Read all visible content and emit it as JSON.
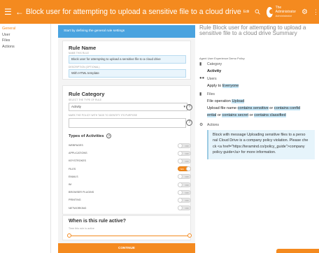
{
  "topbar": {
    "title": "Block user for attempting to upload a sensitive file to a cloud drive",
    "title_small": "Edit",
    "user_name": "The Administrator",
    "user_role": "Administrator"
  },
  "nav": {
    "items": [
      "General",
      "User",
      "Files",
      "Actions"
    ]
  },
  "form": {
    "banner": "Start by defining the general rule settings",
    "rule_name": {
      "title": "Rule Name",
      "name_label": "NAME THIS RULE",
      "name_value": "Block user for attempting to upload a sensitive file to a cloud drive",
      "desc_label": "DESCRIPTION (OPTIONAL)",
      "desc_value": "With HTML template"
    },
    "category": {
      "title": "Rule Category",
      "type_label": "SELECT THE TYPE OF RULE",
      "type_value": "Activity",
      "tags_label": "MARK THE POLICY WITH TAGS TO IDENTIFY ITS PURPOSE",
      "tags_value": ""
    },
    "activities": {
      "title": "Types of Activities",
      "items": [
        {
          "label": "WEBPAGES",
          "state": "OFF",
          "on": false
        },
        {
          "label": "APPLICATIONS",
          "state": "OFF",
          "on": false
        },
        {
          "label": "KEYSTROKES",
          "state": "OFF",
          "on": false
        },
        {
          "label": "FILES",
          "state": "YES",
          "on": true
        },
        {
          "label": "EMAILS",
          "state": "OFF",
          "on": false
        },
        {
          "label": "IM",
          "state": "OFF",
          "on": false
        },
        {
          "label": "BROWSER PLUGINS",
          "state": "OFF",
          "on": false
        },
        {
          "label": "PRINTING",
          "state": "OFF",
          "on": false
        },
        {
          "label": "NETWORKING",
          "state": "OFF",
          "on": false
        }
      ]
    },
    "active": {
      "title": "When is this rule active?",
      "label": "Time this rule is active"
    },
    "continue_label": "CONTINUE"
  },
  "summary": {
    "title": "Rule Block user for attempting to upload a sensitive file to a cloud drive Summary",
    "subtitle": "Agent User Experience Demo Policy",
    "category_head": "Category",
    "category_value": "Activity",
    "users_head": "Users",
    "users_prefix": "Apply to ",
    "users_value": "Everyone",
    "files_head": "Files",
    "files_op_prefix": "File operation ",
    "files_op_value": "Upload",
    "files_l1_prefix": "Upload file name ",
    "files_l1_a": "contains sensitive",
    "files_l1_or": " or ",
    "files_l1_b": "contains confid",
    "files_l2_a": "ential",
    "files_l2_or1": " or ",
    "files_l2_b": "contains secret",
    "files_l2_or2": " or ",
    "files_l2_c": "contains classified",
    "actions_head": "Actions",
    "action_text": "Block with message Uploading sensitive files to a perso\nnal Cloud Drive is a company policy violation. Please che\nck <a href=\"https://teramind.co/policy_guide\">company\npolicy guide</a> for more information."
  },
  "colors": {
    "accent": "#f48a1f",
    "banner": "#4aa3df",
    "highlight": "#c5e6f6"
  }
}
